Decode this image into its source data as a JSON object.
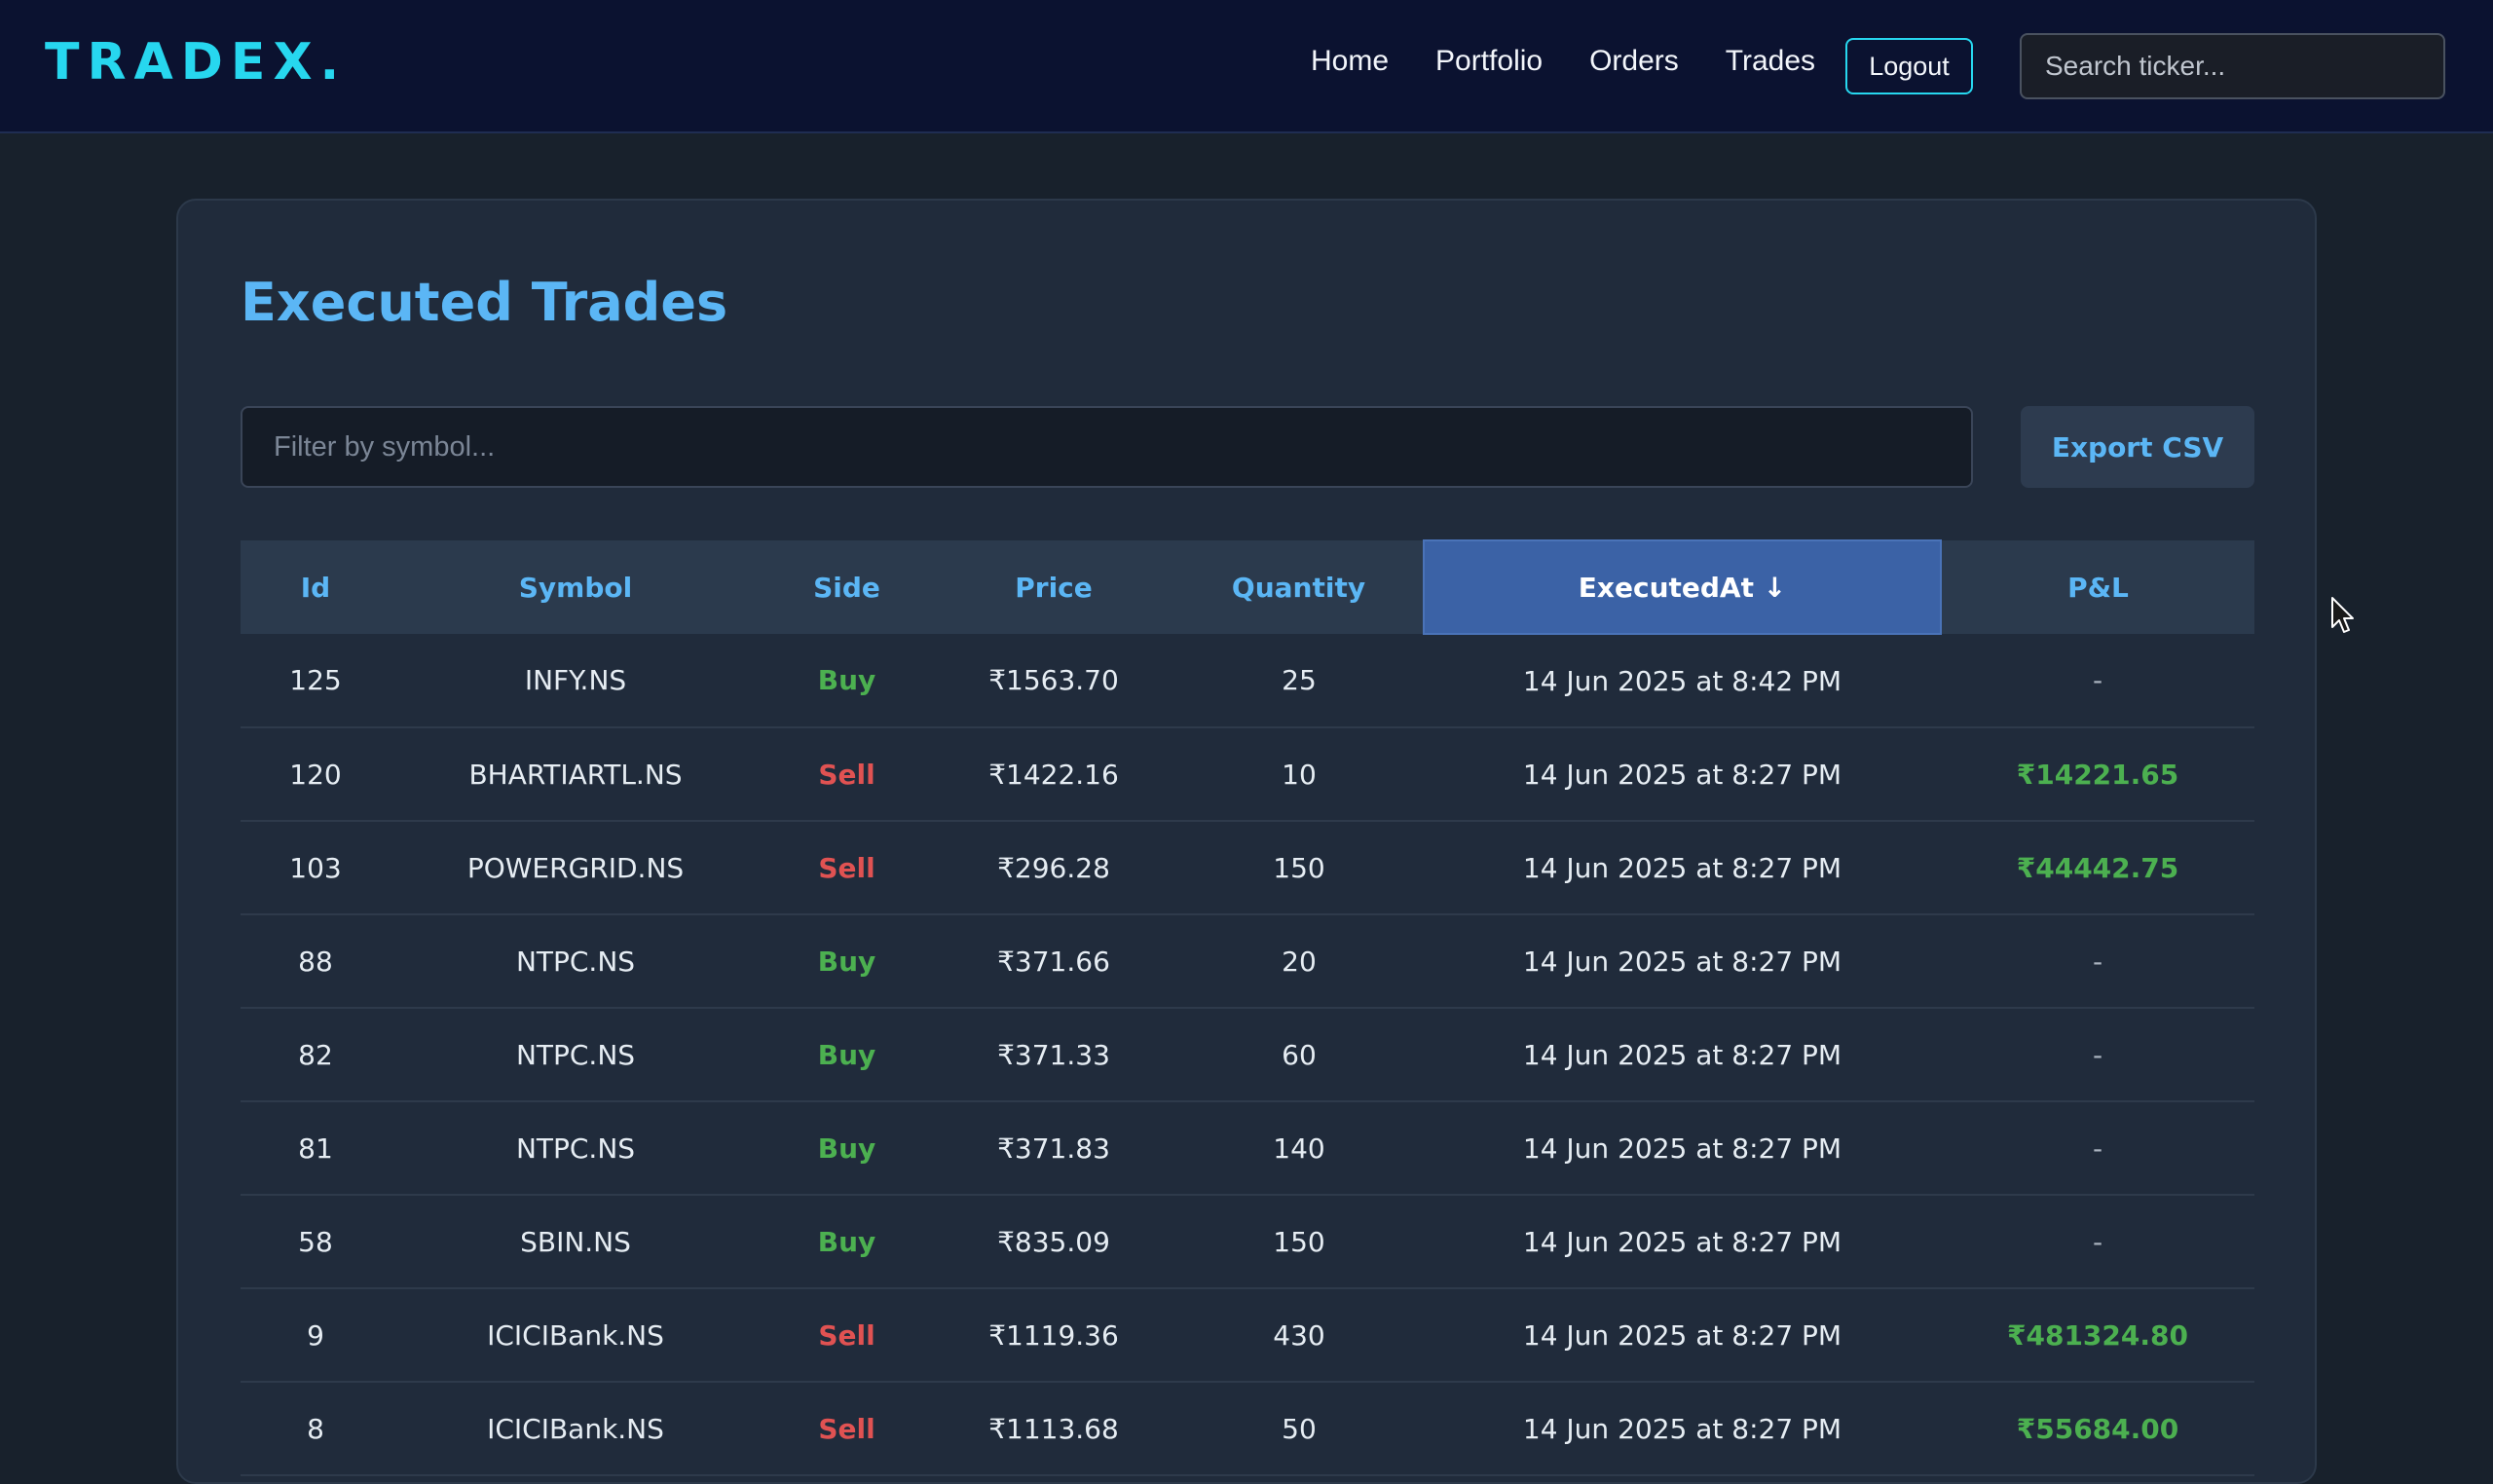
{
  "navbar": {
    "logo": "TRADEX.",
    "links": [
      "Home",
      "Portfolio",
      "Orders",
      "Trades"
    ],
    "logout_label": "Logout",
    "search_placeholder": "Search ticker..."
  },
  "page": {
    "title": "Executed Trades",
    "filter_placeholder": "Filter by symbol...",
    "export_label": "Export CSV"
  },
  "table": {
    "columns": [
      "Id",
      "Symbol",
      "Side",
      "Price",
      "Quantity",
      "ExecutedAt ↓",
      "P&L"
    ],
    "sorted_column": "ExecutedAt",
    "rows": [
      {
        "id": "125",
        "symbol": "INFY.NS",
        "side": "Buy",
        "price": "₹1563.70",
        "quantity": "25",
        "executed_at": "14 Jun 2025 at 8:42 PM",
        "pnl": "-"
      },
      {
        "id": "120",
        "symbol": "BHARTIARTL.NS",
        "side": "Sell",
        "price": "₹1422.16",
        "quantity": "10",
        "executed_at": "14 Jun 2025 at 8:27 PM",
        "pnl": "₹14221.65"
      },
      {
        "id": "103",
        "symbol": "POWERGRID.NS",
        "side": "Sell",
        "price": "₹296.28",
        "quantity": "150",
        "executed_at": "14 Jun 2025 at 8:27 PM",
        "pnl": "₹44442.75"
      },
      {
        "id": "88",
        "symbol": "NTPC.NS",
        "side": "Buy",
        "price": "₹371.66",
        "quantity": "20",
        "executed_at": "14 Jun 2025 at 8:27 PM",
        "pnl": "-"
      },
      {
        "id": "82",
        "symbol": "NTPC.NS",
        "side": "Buy",
        "price": "₹371.33",
        "quantity": "60",
        "executed_at": "14 Jun 2025 at 8:27 PM",
        "pnl": "-"
      },
      {
        "id": "81",
        "symbol": "NTPC.NS",
        "side": "Buy",
        "price": "₹371.83",
        "quantity": "140",
        "executed_at": "14 Jun 2025 at 8:27 PM",
        "pnl": "-"
      },
      {
        "id": "58",
        "symbol": "SBIN.NS",
        "side": "Buy",
        "price": "₹835.09",
        "quantity": "150",
        "executed_at": "14 Jun 2025 at 8:27 PM",
        "pnl": "-"
      },
      {
        "id": "9",
        "symbol": "ICICIBank.NS",
        "side": "Sell",
        "price": "₹1119.36",
        "quantity": "430",
        "executed_at": "14 Jun 2025 at 8:27 PM",
        "pnl": "₹481324.80"
      },
      {
        "id": "8",
        "symbol": "ICICIBank.NS",
        "side": "Sell",
        "price": "₹1113.68",
        "quantity": "50",
        "executed_at": "14 Jun 2025 at 8:27 PM",
        "pnl": "₹55684.00"
      }
    ]
  },
  "colors": {
    "accent": "#27d7ef",
    "title": "#5bb6f5",
    "buy": "#4cb050",
    "sell": "#e05252",
    "sorted_header": "#3b62a6"
  }
}
